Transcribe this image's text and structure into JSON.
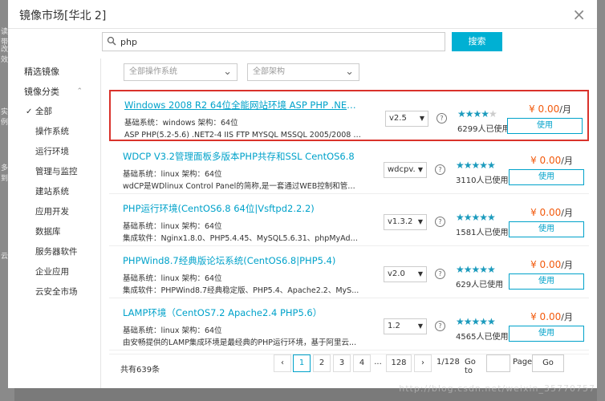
{
  "background": {
    "left_snippets": [
      "读带",
      "改效",
      "实例",
      "多到",
      "云"
    ]
  },
  "dialog": {
    "title": "镜像市场[华北 2]",
    "close_glyph": "×"
  },
  "search": {
    "value": "php",
    "button_label": "搜索"
  },
  "sidebar": {
    "items": [
      {
        "label": "精选镜像"
      },
      {
        "label": "镜像分类",
        "caret": "⌃"
      },
      {
        "label": "全部",
        "selected": true
      },
      {
        "label": "操作系统"
      },
      {
        "label": "运行环境"
      },
      {
        "label": "管理与监控"
      },
      {
        "label": "建站系统"
      },
      {
        "label": "应用开发"
      },
      {
        "label": "数据库"
      },
      {
        "label": "服务器软件"
      },
      {
        "label": "企业应用"
      },
      {
        "label": "云安全市场"
      }
    ]
  },
  "filters": {
    "os": "全部操作系统",
    "arch": "全部架构"
  },
  "listings": [
    {
      "name": "Windows 2008 R2 64位全能网站环境 ASP PHP .NET IIS...",
      "meta": "基础系统：windows    架构：64位",
      "software": "ASP PHP(5.2-5.6) .NET2-4 IIS FTP MYSQL MSSQL 2005/2008 支...",
      "version": "v2.5",
      "rating": 4,
      "users": "6299人已使用",
      "price": "¥ 0.00",
      "price_unit": "/月",
      "button": "使用",
      "highlighted": true
    },
    {
      "name": "WDCP V3.2管理面板多版本PHP共存和SSL CentOS6.8",
      "meta": "基础系统：linux    架构：64位",
      "software": "wdCP是WDlinux Control Panel的简称,是一套通过WEB控制和管理...",
      "version": "wdcpv.",
      "rating": 5,
      "users": "3110人已使用",
      "price": "¥ 0.00",
      "price_unit": "/月",
      "button": "使用"
    },
    {
      "name": "PHP运行环境(CentOS6.8 64位|Vsftpd2.2.2)",
      "meta": "基础系统：linux    架构：64位",
      "software": "集成软件：Nginx1.8.0、PHP5.4.45、MySQL5.6.31、phpMyAdm...",
      "version": "v1.3.2",
      "rating": 5,
      "users": "1581人已使用",
      "price": "¥ 0.00",
      "price_unit": "/月",
      "button": "使用"
    },
    {
      "name": "PHPWind8.7经典版论坛系统(CentOS6.8|PHP5.4)",
      "meta": "基础系统：linux    架构：64位",
      "software": "集成软件：PHPWind8.7经典稳定版、PHP5.4、Apache2.2、MyS...",
      "version": "v2.0",
      "rating": 5,
      "users": "629人已使用",
      "price": "¥ 0.00",
      "price_unit": "/月",
      "button": "使用"
    },
    {
      "name": "LAMP环境（CentOS7.2 Apache2.4 PHP5.6）",
      "meta": "基础系统：linux    架构：64位",
      "software": "由安畅提供的LAMP集成环境是最经典的PHP运行环境，基于阿里云...",
      "version": "1.2",
      "rating": 5,
      "users": "4565人已使用",
      "price": "¥ 0.00",
      "price_unit": "/月",
      "button": "使用"
    }
  ],
  "pagination": {
    "total": "共有639条",
    "prev": "‹",
    "pages": [
      "1",
      "2",
      "3",
      "4"
    ],
    "ellipsis": "...",
    "last": "128",
    "next": "›",
    "page_info": "1/128",
    "goto_label": "Go to",
    "page_label": "Page",
    "go_button": "Go",
    "current": 1
  },
  "watermark": "http://blog.csdn.net/weixin_35770757"
}
